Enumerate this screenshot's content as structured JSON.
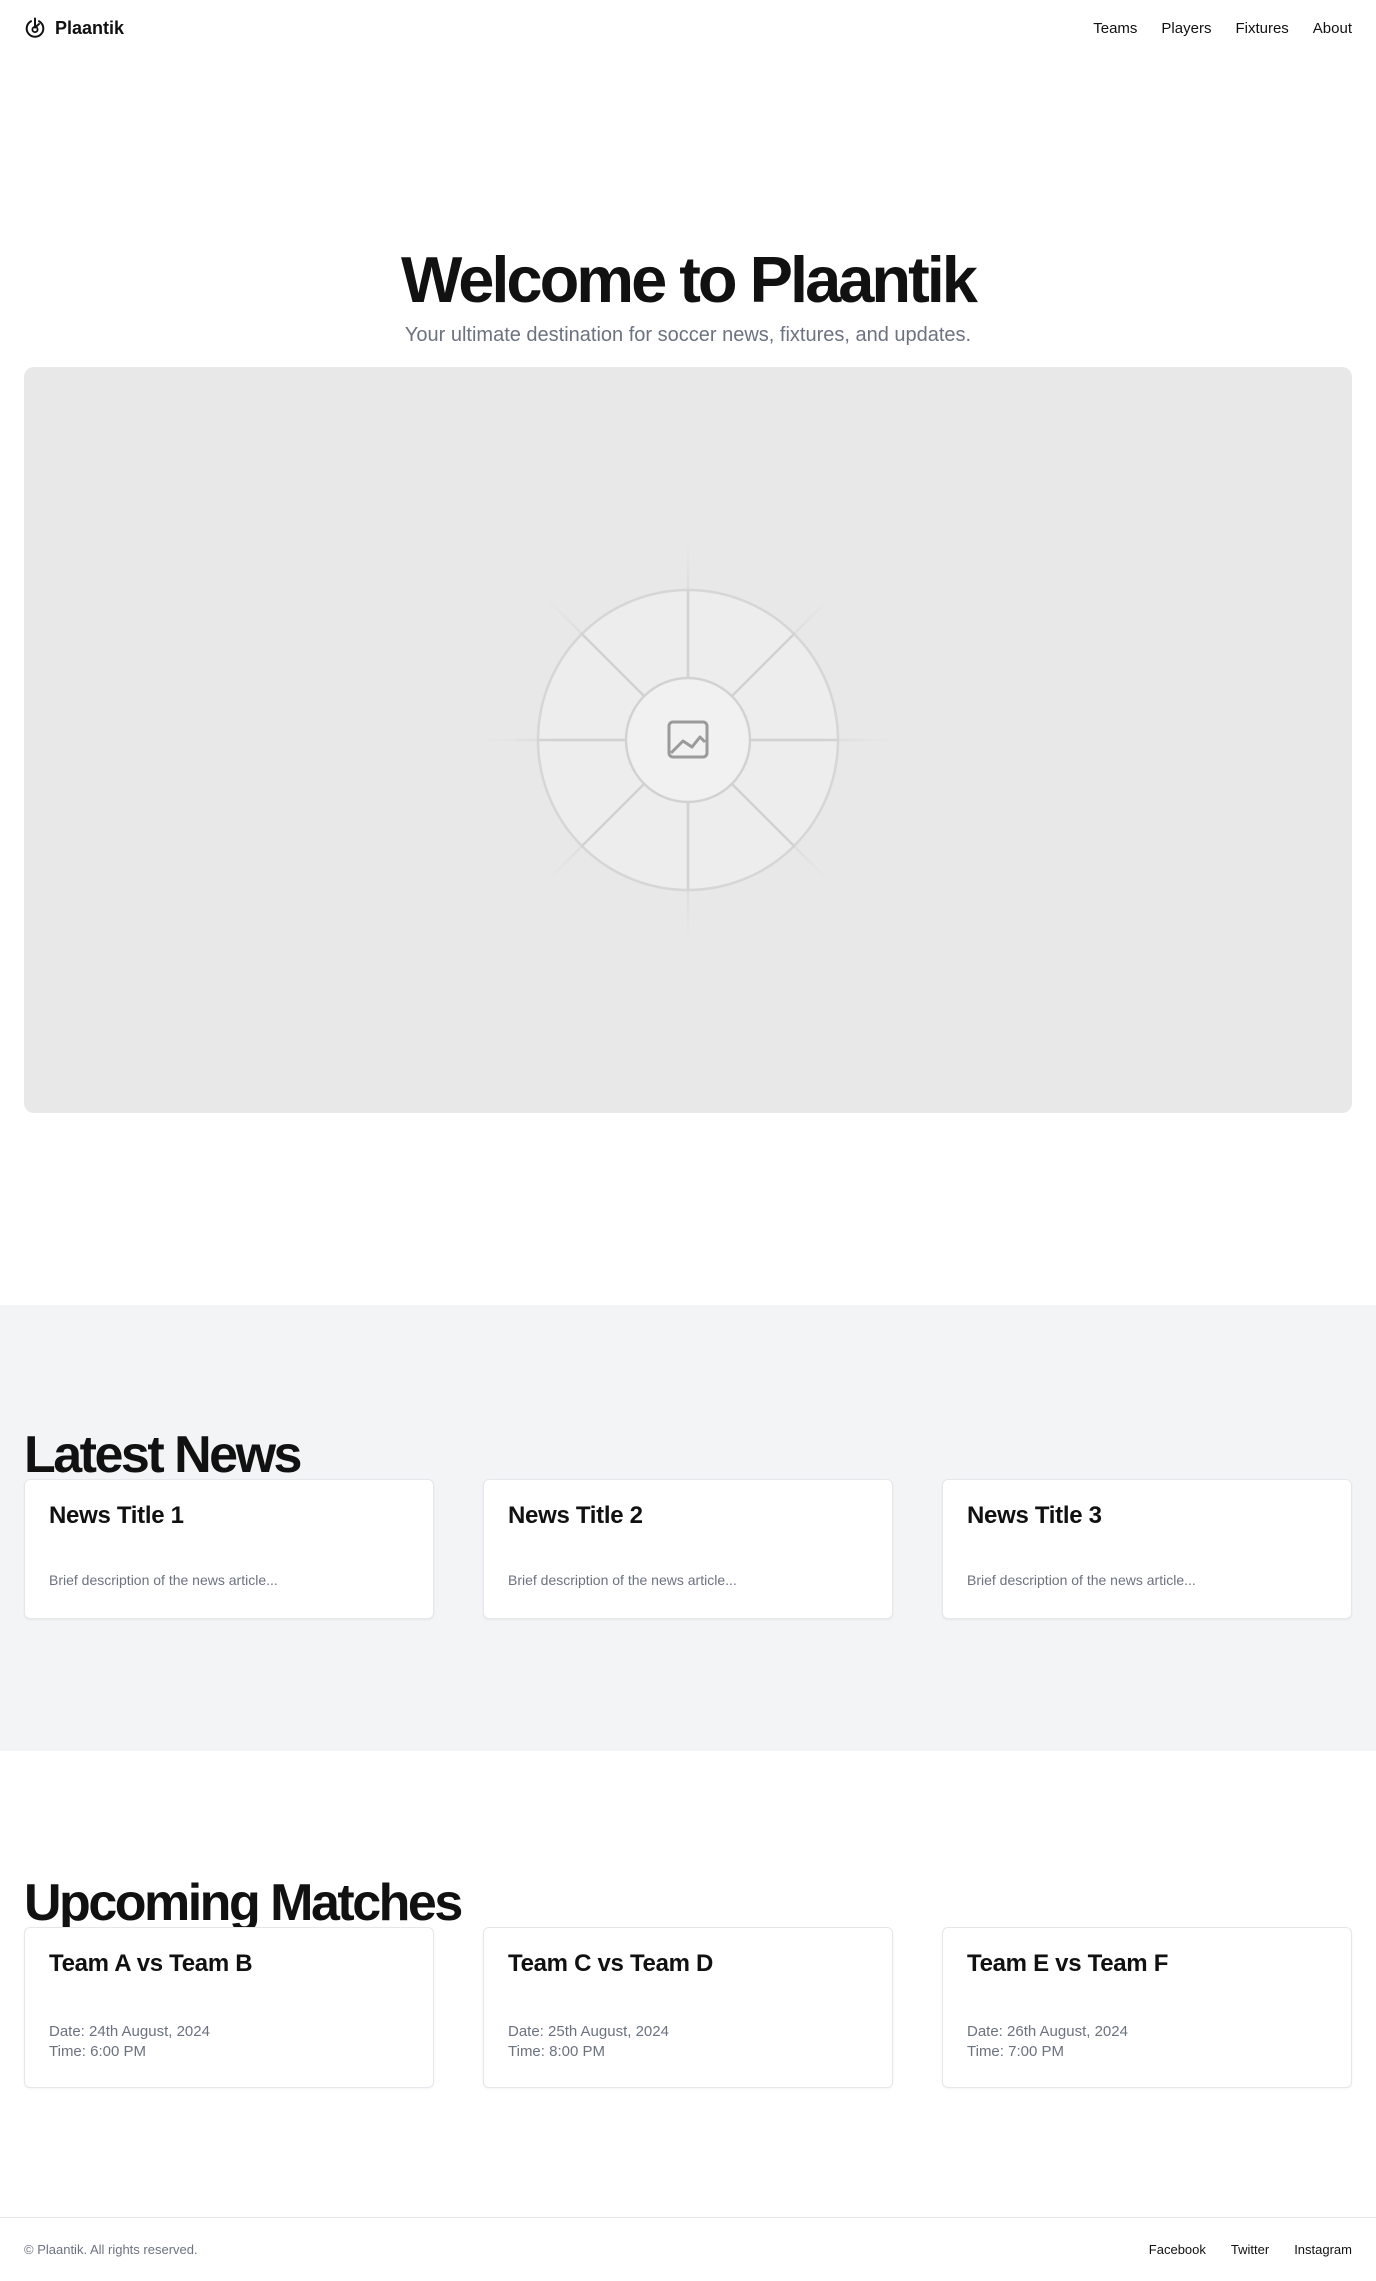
{
  "header": {
    "brand": "Plaantik",
    "nav": [
      "Teams",
      "Players",
      "Fixtures",
      "About"
    ]
  },
  "hero": {
    "title": "Welcome to Plaantik",
    "subtitle": "Your ultimate destination for soccer news, fixtures, and updates.",
    "image_icon": "image-icon"
  },
  "news": {
    "title": "Latest News",
    "items": [
      {
        "title": "News Title 1",
        "description": "Brief description of the news article..."
      },
      {
        "title": "News Title 2",
        "description": "Brief description of the news article..."
      },
      {
        "title": "News Title 3",
        "description": "Brief description of the news article..."
      }
    ]
  },
  "matches": {
    "title": "Upcoming Matches",
    "items": [
      {
        "title": "Team A vs Team B",
        "date": "Date: 24th August, 2024",
        "time": "Time: 6:00 PM"
      },
      {
        "title": "Team C vs Team D",
        "date": "Date: 25th August, 2024",
        "time": "Time: 8:00 PM"
      },
      {
        "title": "Team E vs Team F",
        "date": "Date: 26th August, 2024",
        "time": "Time: 7:00 PM"
      }
    ]
  },
  "footer": {
    "copyright": "© Plaantik. All rights reserved.",
    "social": [
      "Facebook",
      "Twitter",
      "Instagram"
    ]
  },
  "colors": {
    "text": "#111111",
    "muted": "#6b7280",
    "section_bg": "#f3f4f6",
    "placeholder_bg": "#e8e8e8",
    "border": "#e5e7eb"
  }
}
